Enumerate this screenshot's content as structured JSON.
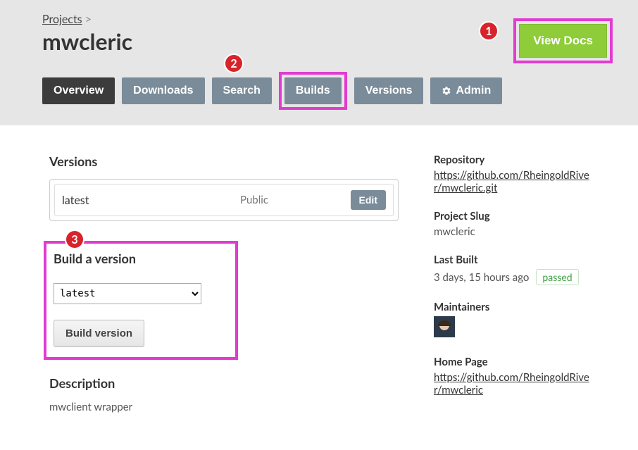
{
  "breadcrumb": {
    "projects": "Projects",
    "sep": ">"
  },
  "project": {
    "title": "mwcleric"
  },
  "actions": {
    "view_docs": "View Docs"
  },
  "tabs": {
    "overview": "Overview",
    "downloads": "Downloads",
    "search": "Search",
    "builds": "Builds",
    "versions": "Versions",
    "admin": "Admin"
  },
  "callouts": {
    "one": "1",
    "two": "2",
    "three": "3"
  },
  "sections": {
    "versions_title": "Versions",
    "build_title": "Build a version",
    "description_title": "Description"
  },
  "versions": [
    {
      "name": "latest",
      "visibility": "Public",
      "edit": "Edit"
    }
  ],
  "build": {
    "options": [
      "latest"
    ],
    "selected": "latest",
    "button": "Build version"
  },
  "description": {
    "text": "mwclient wrapper"
  },
  "sidebar": {
    "repository": {
      "label": "Repository",
      "url": "https://github.com/RheingoldRiver/mwcleric.git"
    },
    "slug": {
      "label": "Project Slug",
      "value": "mwcleric"
    },
    "last_built": {
      "label": "Last Built",
      "value": "3 days, 15 hours ago",
      "status": "passed"
    },
    "maintainers": {
      "label": "Maintainers"
    },
    "home_page": {
      "label": "Home Page",
      "url": "https://github.com/RheingoldRiver/mwcleric"
    }
  }
}
